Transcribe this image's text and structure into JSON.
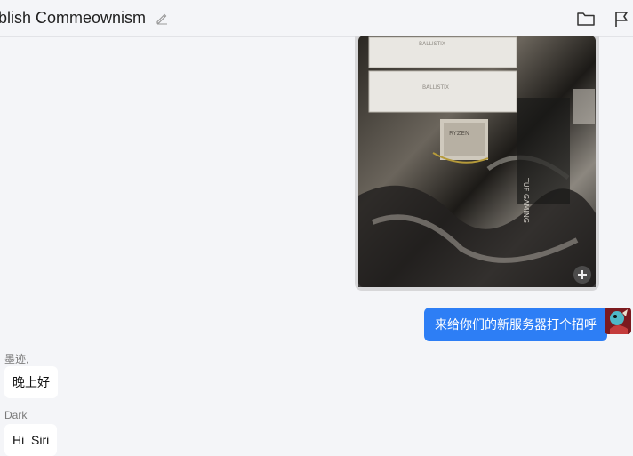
{
  "header": {
    "title": "blish Commeownism",
    "icons": {
      "edit": "pencil-icon",
      "folder": "folder-icon",
      "flag": "flag-icon"
    }
  },
  "messages": [
    {
      "direction": "outgoing",
      "type": "image",
      "image_text": [
        "BALLISTIX",
        "BALLISTIX",
        "RYZEN",
        "TUF GAMING"
      ]
    },
    {
      "direction": "outgoing",
      "type": "text",
      "text": "来给你们的新服务器打个招呼"
    },
    {
      "direction": "incoming",
      "sender": "墨迹,",
      "text": "晚上好"
    },
    {
      "direction": "incoming",
      "sender": "Dark",
      "text": "Hi  Siri"
    }
  ],
  "colors": {
    "background": "#f4f5f8",
    "outgoing_bubble": "#2d7ef5",
    "incoming_bubble": "#ffffff"
  }
}
